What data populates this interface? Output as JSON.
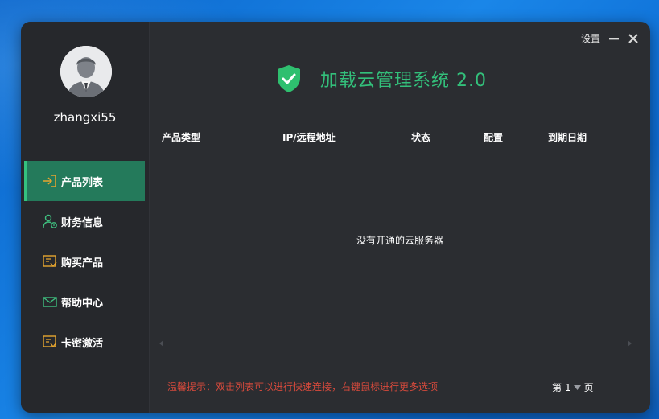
{
  "app": {
    "title": "加载云管理系统 2.0",
    "accent": "#33c07b",
    "brand_green_active": "#247a5b"
  },
  "window_controls": {
    "settings_label": "设置",
    "minimize_icon": "minimize-icon",
    "close_icon": "close-icon"
  },
  "user": {
    "username": "zhangxi55",
    "avatar_icon": "user-avatar-icon"
  },
  "sidebar": {
    "items": [
      {
        "label": "产品列表",
        "icon": "login-arrow-icon",
        "active": true
      },
      {
        "label": "财务信息",
        "icon": "user-finance-icon",
        "active": false
      },
      {
        "label": "购买产品",
        "icon": "purchase-doc-icon",
        "active": false
      },
      {
        "label": "帮助中心",
        "icon": "envelope-icon",
        "active": false
      },
      {
        "label": "卡密激活",
        "icon": "card-key-icon",
        "active": false
      }
    ]
  },
  "table": {
    "columns": [
      "产品类型",
      "IP/远程地址",
      "状态",
      "配置",
      "到期日期"
    ],
    "rows": [],
    "empty_message": "没有开通的云服务器"
  },
  "footer": {
    "tip": "温馨提示：双击列表可以进行快速连接，右键鼠标进行更多选项",
    "tip_color": "#d84a3c",
    "pager_prefix": "第",
    "pager_value": "1",
    "pager_suffix": "页"
  }
}
